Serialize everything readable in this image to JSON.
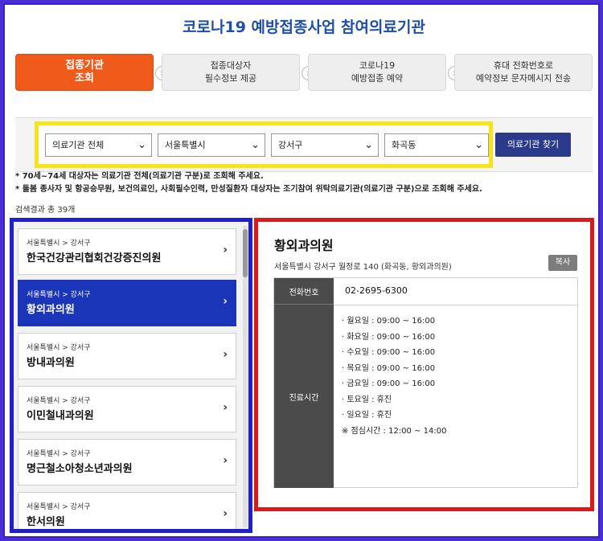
{
  "title": "코로나19 예방접종사업 참여의료기관",
  "steps": [
    {
      "line1": "접종기관",
      "line2": "조회"
    },
    {
      "line1": "접종대상자",
      "line2": "필수정보 제공"
    },
    {
      "line1": "코로나19",
      "line2": "예방접종 예약"
    },
    {
      "line1": "휴대 전화번호로",
      "line2": "예약정보 문자메시지 전송"
    }
  ],
  "step_arrow": "›",
  "filters": {
    "type": "의료기관 전체",
    "city": "서울특별시",
    "district": "강서구",
    "dong": "화곡동",
    "find_button": "의료기관 찾기"
  },
  "notes": [
    "* 70세~74세 대상자는 의료기관 전체(의료기관 구분)로 조회해 주세요.",
    "* 돌봄 종사자 및 항공승무원, 보건의료인, 사회필수인력, 만성질환자 대상자는 조기참여 위탁의료기관(의료기관 구분)으로 조회해 주세요."
  ],
  "result_count": "검색결과 총 39개",
  "list": [
    {
      "crumb": "서울특별시 > 강서구",
      "name": "한국건강관리협회건강증진의원"
    },
    {
      "crumb": "서울특별시 > 강서구",
      "name": "황외과의원"
    },
    {
      "crumb": "서울특별시 > 강서구",
      "name": "방내과의원"
    },
    {
      "crumb": "서울특별시 > 강서구",
      "name": "이민철내과의원"
    },
    {
      "crumb": "서울특별시 > 강서구",
      "name": "명근철소아청소년과의원"
    },
    {
      "crumb": "서울특별시 > 강서구",
      "name": "한서의원"
    }
  ],
  "detail": {
    "name": "황외과의원",
    "address": "서울특별시 강서구 월정로 140 (화곡동, 황외과의원)",
    "copy_button": "복사",
    "phone_label": "전화번호",
    "phone": "02-2695-6300",
    "hours_label": "진료시간",
    "hours": [
      "· 월요일 : 09:00 ~ 16:00",
      "· 화요일 : 09:00 ~ 16:00",
      "· 수요일 : 09:00 ~ 16:00",
      "· 목요일 : 09:00 ~ 16:00",
      "· 금요일 : 09:00 ~ 16:00",
      "· 토요일 : 휴진",
      "· 일요일 : 휴진",
      "※ 점심시간 : 12:00 ~ 14:00"
    ]
  },
  "colors": {
    "active_step": "#f05a1a",
    "active_list": "#1a35b8",
    "find_button": "#2b3a8a",
    "highlight_yellow": "#f6e51b",
    "highlight_blue": "#1f1fd1",
    "highlight_red": "#d81a1a"
  }
}
